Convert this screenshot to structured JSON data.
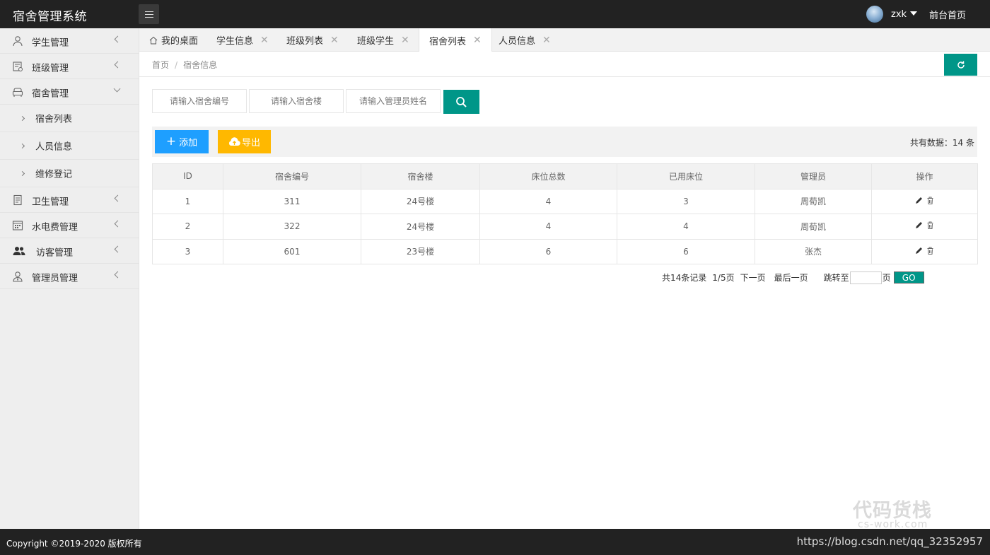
{
  "header": {
    "app_title": "宿舍管理系统",
    "username": "zxk",
    "front_link": "前台首页"
  },
  "sidebar": {
    "items": [
      {
        "label": "学生管理",
        "icon": "user-icon"
      },
      {
        "label": "班级管理",
        "icon": "calendar-icon"
      },
      {
        "label": "宿舍管理",
        "icon": "sofa-icon",
        "expanded": true
      },
      {
        "label": "卫生管理",
        "icon": "document-icon"
      },
      {
        "label": "水电费管理",
        "icon": "grid-icon"
      },
      {
        "label": "访客管理",
        "icon": "users-icon"
      },
      {
        "label": "管理员管理",
        "icon": "admin-icon"
      }
    ],
    "subitems": [
      {
        "label": "宿舍列表"
      },
      {
        "label": "人员信息"
      },
      {
        "label": "维修登记"
      }
    ]
  },
  "tabs": [
    {
      "label": "我的桌面",
      "icon": "home-icon",
      "closable": false
    },
    {
      "label": "学生信息",
      "closable": true
    },
    {
      "label": "班级列表",
      "closable": true
    },
    {
      "label": "班级学生",
      "closable": true
    },
    {
      "label": "宿舍列表",
      "closable": true,
      "active": true
    },
    {
      "label": "人员信息",
      "closable": true
    }
  ],
  "breadcrumb": {
    "home": "首页",
    "separator": "/",
    "current": "宿舍信息"
  },
  "search": {
    "room_no_placeholder": "请输入宿舍编号",
    "building_placeholder": "请输入宿舍楼",
    "manager_placeholder": "请输入管理员姓名"
  },
  "toolbar": {
    "add_label": "添加",
    "export_label": "导出",
    "total_text": "共有数据：14 条"
  },
  "table": {
    "headers": [
      "ID",
      "宿舍编号",
      "宿舍楼",
      "床位总数",
      "已用床位",
      "管理员",
      "操作"
    ],
    "rows": [
      [
        "1",
        "311",
        "24号楼",
        "4",
        "3",
        "周荀凯"
      ],
      [
        "2",
        "322",
        "24号楼",
        "4",
        "4",
        "周荀凯"
      ],
      [
        "3",
        "601",
        "23号楼",
        "6",
        "6",
        "张杰"
      ]
    ]
  },
  "pagination": {
    "total_records": "共14条记录",
    "page_info": "1/5页",
    "next": "下一页",
    "last": "最后一页",
    "jump_to": "跳转至",
    "page_suffix": "页",
    "go": "GO"
  },
  "footer": {
    "copyright": "Copyright ©2019-2020 版权所有",
    "blog_url": "https://blog.csdn.net/qq_32352957"
  },
  "watermark": {
    "title": "代码货栈",
    "subtitle": "cs-work.com"
  },
  "colors": {
    "header_bg": "#222222",
    "sidebar_bg": "#eeeeee",
    "primary_teal": "#009688",
    "add_blue": "#1E9FFF",
    "export_orange": "#FFB800"
  }
}
